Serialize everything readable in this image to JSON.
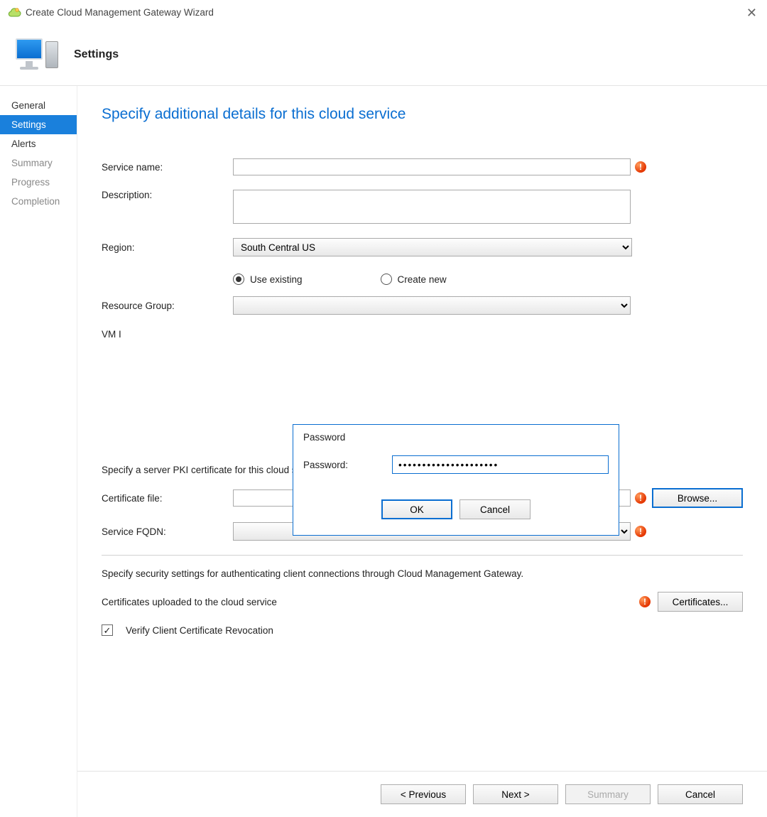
{
  "window": {
    "title": "Create Cloud Management Gateway Wizard"
  },
  "header": {
    "title": "Settings"
  },
  "sidebar": {
    "items": [
      {
        "label": "General"
      },
      {
        "label": "Settings"
      },
      {
        "label": "Alerts"
      },
      {
        "label": "Summary"
      },
      {
        "label": "Progress"
      },
      {
        "label": "Completion"
      }
    ]
  },
  "main": {
    "title": "Specify additional details for this cloud service",
    "labels": {
      "service_name": "Service name:",
      "description": "Description:",
      "region": "Region:",
      "resource_group": "Resource Group:",
      "vm_instance": "VM Instance:",
      "use_existing": "Use existing",
      "create_new": "Create new",
      "pki_text": "Specify a server PKI certificate for this cloud service.",
      "certificate_file": "Certificate file:",
      "browse": "Browse...",
      "service_fqdn": "Service FQDN:",
      "sec_text": "Specify security settings for authenticating client connections through Cloud Management Gateway.",
      "certs_uploaded": "Certificates uploaded to the cloud service",
      "certificates_btn": "Certificates...",
      "verify_crl": "Verify Client Certificate Revocation"
    },
    "values": {
      "service_name": "",
      "description": "",
      "region": "South Central US",
      "resource_group": "",
      "certificate_file": "",
      "service_fqdn": "",
      "selected_rg_option": "use_existing",
      "verify_crl_checked": true
    }
  },
  "dialog": {
    "title": "Password",
    "label": "Password:",
    "value": "•••••••••••••••••••••",
    "ok": "OK",
    "cancel": "Cancel"
  },
  "footer": {
    "previous": "< Previous",
    "next": "Next >",
    "summary": "Summary",
    "cancel": "Cancel"
  },
  "icons": {
    "warn": "!"
  }
}
